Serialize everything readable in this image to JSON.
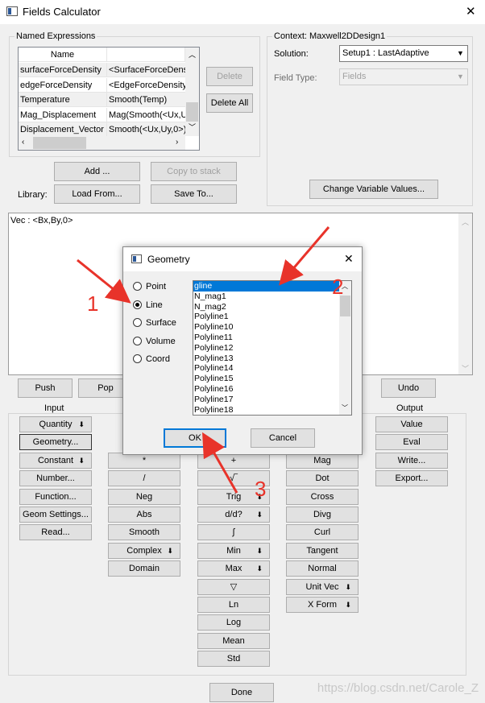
{
  "window": {
    "title": "Fields Calculator",
    "close_glyph": "✕"
  },
  "named_expressions": {
    "legend": "Named Expressions",
    "header": "Name",
    "rows": [
      [
        "surfaceForceDensity",
        "<SurfaceForceDens"
      ],
      [
        "edgeForceDensity",
        "<EdgeForceDensity"
      ],
      [
        "Temperature",
        "Smooth(Temp)"
      ],
      [
        "Mag_Displacement",
        "Mag(Smooth(<Ux,Uy,"
      ],
      [
        "Displacement_Vector",
        "Smooth(<Ux,Uy,0>)"
      ]
    ],
    "delete": "Delete",
    "delete_all": "Delete All",
    "add": "Add ...",
    "copy_to_stack": "Copy to stack",
    "library_label": "Library:",
    "load_from": "Load From...",
    "save_to": "Save To..."
  },
  "context": {
    "legend": "Context: Maxwell2DDesign1",
    "solution_label": "Solution:",
    "solution_value": "Setup1 : LastAdaptive",
    "field_type_label": "Field Type:",
    "field_type_value": "Fields",
    "change_vars": "Change Variable Values..."
  },
  "stack": {
    "top": "Vec : <Bx,By,0>"
  },
  "toolbar": {
    "push": "Push",
    "pop": "Pop",
    "undo": "Undo",
    "input_label": "Input",
    "output_label": "Output"
  },
  "input_buttons": [
    "Quantity",
    "Geometry...",
    "Constant",
    "Number...",
    "Function...",
    "Geom Settings...",
    "Read..."
  ],
  "col2_buttons": [
    "*",
    "/",
    "Neg",
    "Abs",
    "Smooth",
    "Complex",
    "Domain"
  ],
  "col3_buttons": [
    "+",
    "√‾",
    "Trig",
    "d/d?",
    "∫",
    "Min",
    "Max",
    "▽",
    "Ln",
    "Log",
    "Mean",
    "Std"
  ],
  "col4_buttons": [
    "Mag",
    "Dot",
    "Cross",
    "Divg",
    "Curl",
    "Tangent",
    "Normal",
    "Unit Vec",
    "X Form"
  ],
  "output_buttons": [
    "Value",
    "Eval",
    "Write...",
    "Export..."
  ],
  "done": "Done",
  "dialog": {
    "title": "Geometry",
    "radios": [
      "Point",
      "Line",
      "Surface",
      "Volume",
      "Coord"
    ],
    "selected_radio": "Line",
    "items": [
      "gline",
      "N_mag1",
      "N_mag2",
      "Polyline1",
      "Polyline10",
      "Polyline11",
      "Polyline12",
      "Polyline13",
      "Polyline14",
      "Polyline15",
      "Polyline16",
      "Polyline17",
      "Polyline18"
    ],
    "ok": "OK",
    "cancel": "Cancel"
  },
  "annotations": [
    "1",
    "2",
    "3"
  ],
  "watermark": "https://blog.csdn.net/Carole_Z",
  "colors": {
    "arrow": "#e8332a",
    "selection": "#0078d7"
  }
}
